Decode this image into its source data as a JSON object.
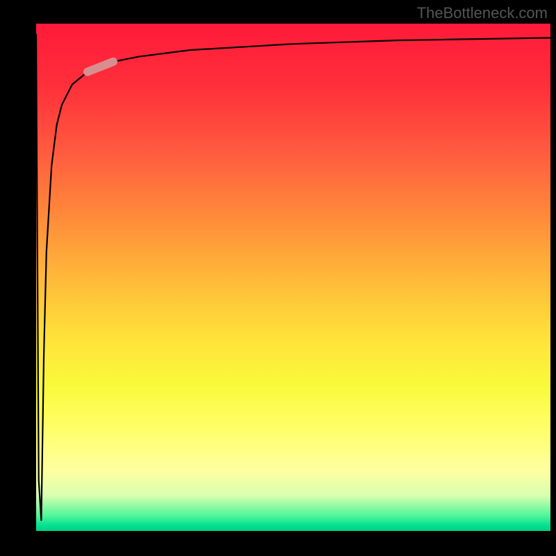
{
  "watermark": "TheBottleneck.com",
  "chart_data": {
    "type": "line",
    "title": "",
    "xlabel": "",
    "ylabel": "",
    "xlim": [
      0,
      100
    ],
    "ylim": [
      0,
      100
    ],
    "series": [
      {
        "name": "curve",
        "x": [
          0.0,
          0.5,
          1.0,
          1.5,
          2.0,
          3.0,
          4.0,
          5.0,
          7.0,
          10.0,
          15.0,
          20.0,
          30.0,
          50.0,
          70.0,
          100.0
        ],
        "y": [
          98.0,
          10.0,
          2.0,
          35.0,
          55.0,
          72.0,
          80.0,
          84.0,
          88.0,
          90.5,
          92.5,
          93.5,
          94.8,
          96.0,
          96.7,
          97.2
        ]
      }
    ],
    "marker": {
      "x_start": 10.0,
      "y_start": 90.5,
      "x_end": 15.0,
      "y_end": 92.5,
      "color": "#d88e8e",
      "width": 12
    },
    "gradient_stops": [
      {
        "pos": 0,
        "color": "#ff1a3a"
      },
      {
        "pos": 25,
        "color": "#ff5a3f"
      },
      {
        "pos": 50,
        "color": "#ffb83a"
      },
      {
        "pos": 75,
        "color": "#ffff3a"
      },
      {
        "pos": 100,
        "color": "#00d080"
      }
    ]
  }
}
